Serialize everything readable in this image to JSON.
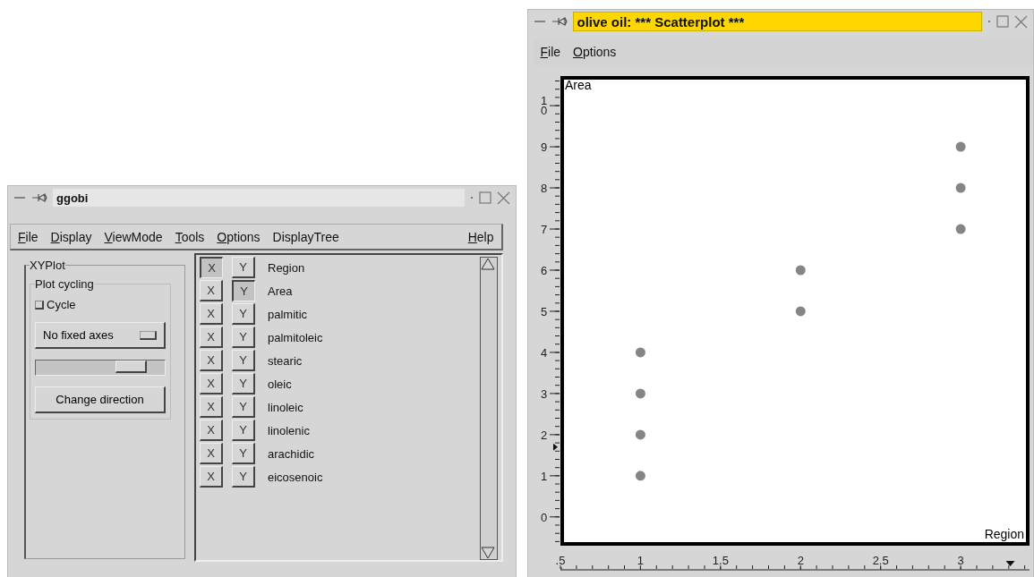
{
  "main_window": {
    "title": "ggobi",
    "active": false,
    "menu": [
      {
        "label": "File",
        "mnemonic": true
      },
      {
        "label": "Display",
        "mnemonic": true
      },
      {
        "label": "ViewMode",
        "mnemonic": true
      },
      {
        "label": "Tools",
        "mnemonic": true
      },
      {
        "label": "Options",
        "mnemonic": true
      },
      {
        "label": "DisplayTree",
        "mnemonic": false
      },
      {
        "label": "Help",
        "mnemonic": true
      }
    ],
    "xyplot": {
      "title": "XYPlot",
      "cycling_title": "Plot cycling",
      "cycle": {
        "label": "Cycle",
        "checked": false
      },
      "axes_button": "No fixed axes",
      "speed": {
        "level": 0.82
      },
      "direction_button": "Change direction"
    },
    "variables": [
      {
        "x_label": "X",
        "x_selected": true,
        "y_label": "Y",
        "y_selected": false,
        "name": "Region"
      },
      {
        "x_label": "X",
        "x_selected": false,
        "y_label": "Y",
        "y_selected": true,
        "name": "Area"
      },
      {
        "x_label": "X",
        "x_selected": false,
        "y_label": "Y",
        "y_selected": false,
        "name": "palmitic"
      },
      {
        "x_label": "X",
        "x_selected": false,
        "y_label": "Y",
        "y_selected": false,
        "name": "palmitoleic"
      },
      {
        "x_label": "X",
        "x_selected": false,
        "y_label": "Y",
        "y_selected": false,
        "name": "stearic"
      },
      {
        "x_label": "X",
        "x_selected": false,
        "y_label": "Y",
        "y_selected": false,
        "name": "oleic"
      },
      {
        "x_label": "X",
        "x_selected": false,
        "y_label": "Y",
        "y_selected": false,
        "name": "linoleic"
      },
      {
        "x_label": "X",
        "x_selected": false,
        "y_label": "Y",
        "y_selected": false,
        "name": "linolenic"
      },
      {
        "x_label": "X",
        "x_selected": false,
        "y_label": "Y",
        "y_selected": false,
        "name": "arachidic"
      },
      {
        "x_label": "X",
        "x_selected": false,
        "y_label": "Y",
        "y_selected": false,
        "name": "eicosenoic"
      }
    ]
  },
  "plot_window": {
    "title": "olive oil: *** Scatterplot ***",
    "active": true,
    "menu": [
      {
        "label": "File",
        "mnemonic": true
      },
      {
        "label": "Options",
        "mnemonic": true
      }
    ],
    "chart_data": {
      "type": "scatter",
      "xlabel": "Region",
      "ylabel": "Area",
      "x": [
        1,
        1,
        1,
        1,
        2,
        2,
        3,
        3,
        3
      ],
      "series": [
        {
          "color": "#858585",
          "values": [
            1,
            2,
            3,
            4,
            5,
            6,
            7,
            8,
            9
          ]
        }
      ],
      "xlim": [
        0.5,
        3.43
      ],
      "ylim": [
        -0.7,
        10.72
      ],
      "xticks": [
        {
          "value": 0.5,
          "label": ".5"
        },
        1,
        1.5,
        2,
        2.5,
        3
      ],
      "yticks": [
        0,
        1,
        2,
        3,
        4,
        5,
        6,
        7,
        8,
        9,
        10
      ]
    }
  }
}
